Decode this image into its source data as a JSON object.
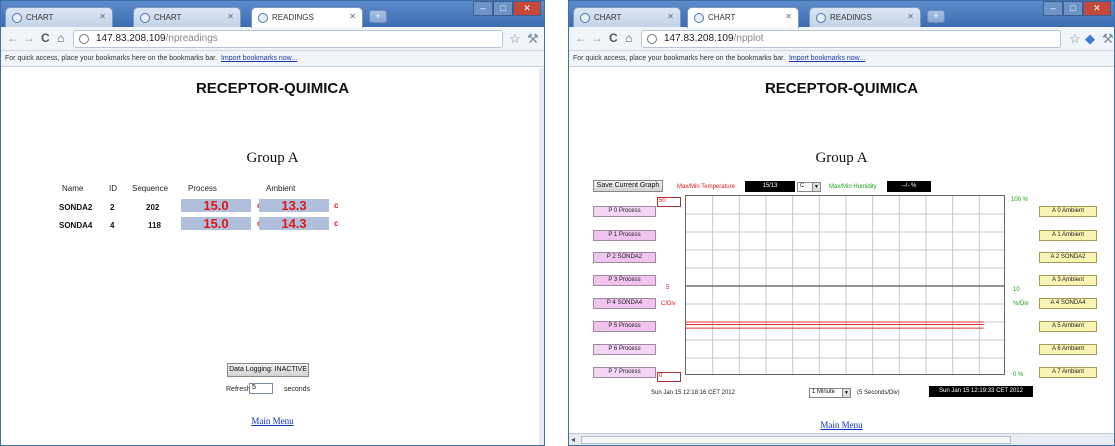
{
  "left_window": {
    "tabs": [
      {
        "label": "CHART"
      },
      {
        "label": "CHART"
      },
      {
        "label": "READINGS"
      }
    ],
    "url_host": "147.83.208.109",
    "url_path": "/npreadings",
    "bookmark_bar": {
      "text": "For quick access, place your bookmarks here on the bookmarks bar.",
      "link": "Import bookmarks now..."
    },
    "page_title": "RECEPTOR-QUIMICA",
    "group_title": "Group A",
    "table_headers": {
      "name": "Name",
      "id": "ID",
      "sequence": "Sequence",
      "process": "Process",
      "ambient": "Ambient"
    },
    "rows": [
      {
        "name": "SONDA2",
        "id": "2",
        "sequence": "202",
        "process": "15.0",
        "process_unit": "c",
        "ambient": "13.3",
        "ambient_unit": "c"
      },
      {
        "name": "SONDA4",
        "id": "4",
        "sequence": "118",
        "process": "15.0",
        "process_unit": "c",
        "ambient": "14.3",
        "ambient_unit": "c"
      }
    ],
    "data_logging_button": "Data Logging: INACTIVE",
    "refresh_label": "Refresh:",
    "refresh_value": "5",
    "refresh_unit": "seconds",
    "main_menu": "Main Menu"
  },
  "right_window": {
    "tabs": [
      {
        "label": "CHART"
      },
      {
        "label": "CHART"
      },
      {
        "label": "READINGS"
      }
    ],
    "url_host": "147.83.208.109",
    "url_path": "/npplot",
    "bookmark_bar": {
      "text": "For quick access, place your bookmarks here on the bookmarks bar.",
      "link": "Import bookmarks now..."
    },
    "page_title": "RECEPTOR-QUIMICA",
    "group_title": "Group A",
    "save_button": "Save Current Graph",
    "temp_label": "Max/Min Temperature",
    "temp_value": "15/13",
    "temp_unit": "C",
    "humidity_label": "Max/Min Humidity",
    "humidity_value": "--/- %",
    "process_buttons": [
      "P 0 Process",
      "P 1 Process",
      "P 2  SONDA2",
      "P 3 Process",
      "P 4  SONDA4",
      "P 5 Process",
      "P 6 Process",
      "P 7 Process"
    ],
    "ambient_buttons": [
      "A 0 Ambient",
      "A 1 Ambient",
      "A 2  SONDA2",
      "A 3 Ambient",
      "A 4  SONDA4",
      "A 5 Ambient",
      "A 6 Ambient",
      "A 7 Ambient"
    ],
    "left_axis": {
      "max": "50",
      "mid": "5",
      "unit": "C/Div",
      "min": "0"
    },
    "right_axis": {
      "max": "100 %",
      "mid": "10",
      "unit": "%/Div",
      "min": "0 %"
    },
    "start_time": "Sun Jan 15 12:18:16 CET 2012",
    "interval_select": "1 Minute",
    "interval_note": "(5 Seconds/Div)",
    "end_time": "Sun Jan 15 12:19:33 CET 2012",
    "main_menu": "Main Menu"
  },
  "chart_data": {
    "type": "line",
    "xlabel": "",
    "ylabel": "",
    "ylim": [
      0,
      50
    ],
    "grid": true,
    "gridlines": {
      "x_divisions": 12,
      "y_divisions": 10
    },
    "series": [
      {
        "values": [
          15,
          15,
          15,
          15,
          15,
          15,
          15,
          15,
          15,
          15,
          15,
          15,
          15,
          15,
          15,
          15
        ],
        "color": "#e03030"
      },
      {
        "values": [
          14.3,
          14.3,
          14.3,
          14.3,
          14.3,
          14.3,
          14.3,
          14.3,
          14.3,
          14.3,
          14.3,
          14.3,
          14.3,
          14.3,
          14.3,
          14.3
        ],
        "color": "#e03030"
      },
      {
        "values": [
          13.3,
          13.3,
          13.3,
          13.3,
          13.3,
          13.3,
          13.3,
          13.3,
          13.3,
          13.3,
          13.3,
          13.3,
          13.3,
          13.3,
          13.3,
          13.3
        ],
        "color": "#e03030"
      }
    ],
    "reference_line": {
      "value": 10,
      "axis": "right",
      "color": "#555555"
    }
  }
}
